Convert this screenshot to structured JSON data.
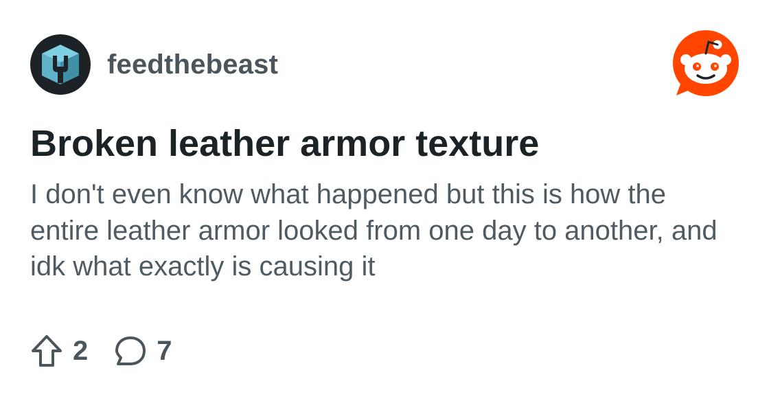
{
  "post": {
    "subreddit": "feedthebeast",
    "title": "Broken leather armor texture",
    "body": "I don't even know what happened but this is how the entire leather armor looked from one day to another, and idk what exactly is causing it"
  },
  "actions": {
    "upvotes": "2",
    "comments": "7"
  },
  "icons": {
    "subreddit_avatar": "ftb-logo-icon",
    "brand": "reddit-snoo-icon",
    "upvote": "upvote-arrow-icon",
    "comment": "comment-bubble-icon"
  },
  "colors": {
    "brand": "#ff4500",
    "title_text": "#1c2327",
    "body_text": "#4f5b62",
    "meta_text": "#4b555c",
    "avatar_bg": "#1c2226",
    "avatar_accent": "#5fb3c9"
  }
}
